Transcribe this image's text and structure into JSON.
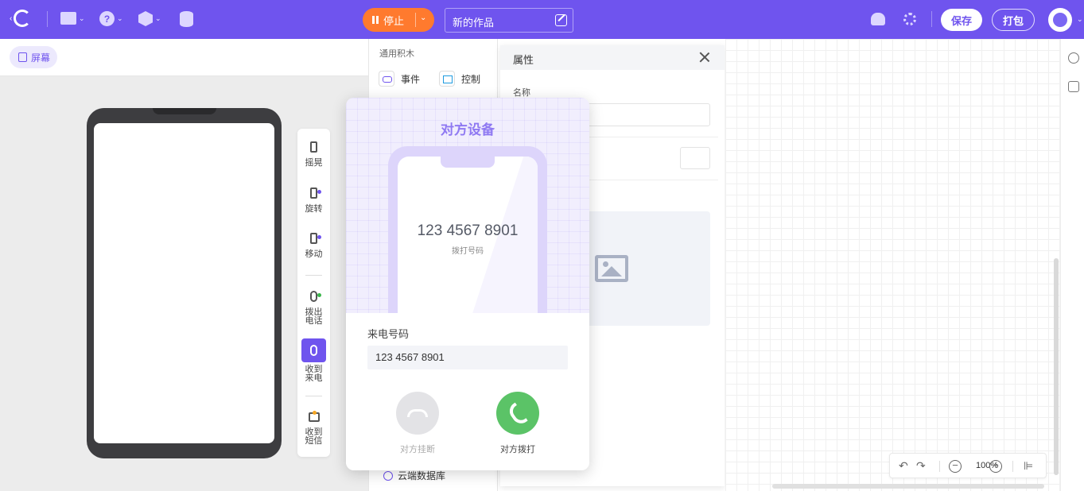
{
  "toolbar": {
    "stop_label": "停止",
    "project_name": "新的作品",
    "save_label": "保存",
    "pack_label": "打包",
    "icons": [
      "logo-icon",
      "folder-icon",
      "help-icon",
      "extension-icon",
      "database-icon",
      "users-icon",
      "share-icon"
    ]
  },
  "stage": {
    "screen_tab": "屏幕"
  },
  "sensors": {
    "shake": "摇晃",
    "rotate": "旋转",
    "move": "移动",
    "call_out": "拨出电话",
    "incoming_call": "收到来电",
    "sms": "收到短信"
  },
  "blocks": {
    "title": "通用积木",
    "event": "事件",
    "control": "控制",
    "cloud_db": "云端数据库"
  },
  "properties": {
    "title": "属性",
    "name_label": "名称"
  },
  "zoom": {
    "level": "100%"
  },
  "dialog": {
    "title": "对方设备",
    "number_display": "123 4567 8901",
    "number_caption": "拨打号码",
    "caller_label": "来电号码",
    "caller_value": "123 4567 8901",
    "hangup_label": "对方挂断",
    "dial_label": "对方拨打"
  },
  "colors": {
    "brand": "#6f54ee",
    "stop": "#ff7a2e",
    "dial": "#5bc367",
    "hangup": "#e3e3e6"
  }
}
